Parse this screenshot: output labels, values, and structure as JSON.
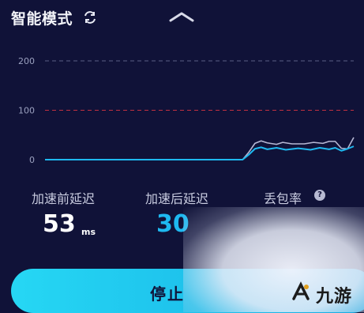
{
  "header": {
    "title": "智能模式"
  },
  "chart_data": {
    "type": "line",
    "y_ticks": [
      "200",
      "100",
      "0"
    ],
    "ylim": [
      0,
      200
    ],
    "grid": "dashed",
    "series": [
      {
        "color": "#b6b8d4",
        "points": [
          [
            0,
            0
          ],
          [
            64,
            0
          ],
          [
            66,
            15
          ],
          [
            68,
            33
          ],
          [
            70,
            38
          ],
          [
            72,
            34
          ],
          [
            75,
            31
          ],
          [
            77,
            35
          ],
          [
            80,
            32
          ],
          [
            84,
            32
          ],
          [
            87,
            35
          ],
          [
            90,
            33
          ],
          [
            92,
            37
          ],
          [
            94,
            37
          ],
          [
            96,
            23
          ],
          [
            98,
            22
          ],
          [
            100,
            45
          ]
        ]
      },
      {
        "color": "#1eb8f0",
        "points": [
          [
            0,
            0
          ],
          [
            64,
            0
          ],
          [
            66,
            10
          ],
          [
            68,
            22
          ],
          [
            70,
            25
          ],
          [
            72,
            21
          ],
          [
            75,
            24
          ],
          [
            78,
            20
          ],
          [
            82,
            23
          ],
          [
            86,
            20
          ],
          [
            89,
            24
          ],
          [
            92,
            21
          ],
          [
            94,
            24
          ],
          [
            96,
            18
          ],
          [
            98,
            22
          ],
          [
            100,
            27
          ]
        ]
      }
    ]
  },
  "stats": {
    "before_label": "加速前延迟",
    "before_value": "53",
    "before_unit": "ms",
    "after_label": "加速后延迟",
    "after_value": "30",
    "loss_label": "丢包率",
    "help_glyph": "?"
  },
  "actions": {
    "stop_label": "停止"
  },
  "watermark": {
    "text": "九游"
  },
  "colors": {
    "background": "#101238",
    "accent": "#1eb8f0",
    "grid_red": "#c03040",
    "grid_gray": "#5a5e84"
  },
  "icons": [
    "refresh-icon",
    "chevron-up-icon",
    "help-icon",
    "watermark-logo-icon"
  ]
}
